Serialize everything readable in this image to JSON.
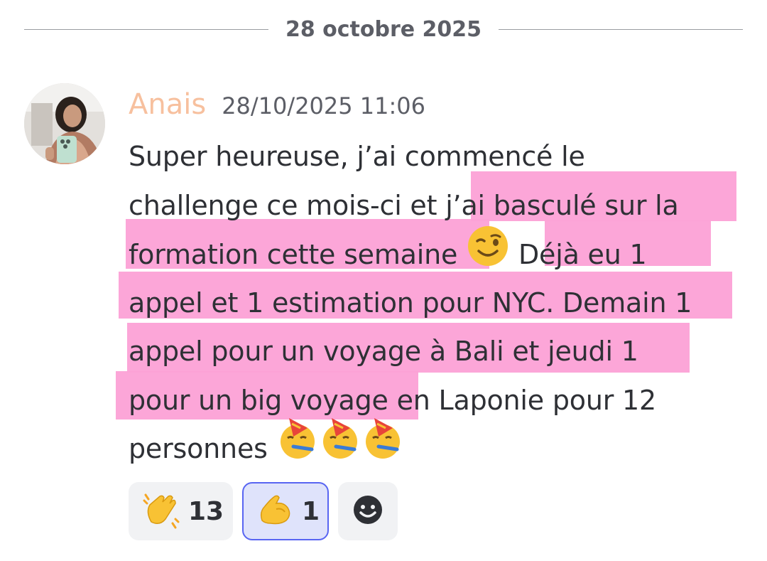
{
  "divider": {
    "date": "28 octobre 2025"
  },
  "message": {
    "author": "Anais",
    "timestamp": "28/10/2025 11:06",
    "lines": [
      {
        "before": "Super heureuse, j’ai commencé le",
        "highlight": "",
        "after": ""
      },
      {
        "before": "challenge ce mois-ci et ",
        "highlight": "j’ai basculé sur la",
        "after": ""
      },
      {
        "before": "",
        "highlight": "formation cette semaine",
        "after": ""
      },
      {
        "before": "",
        "highlight": "Déjà eu 1",
        "after": ""
      },
      {
        "before": "",
        "highlight": "appel et 1 estimation pour NYC. Demain 1",
        "after": ""
      },
      {
        "before": "",
        "highlight": "appel pour un voyage à Bali et jeudi 1",
        "after": ""
      },
      {
        "before": "",
        "highlight": "pour un big voyage",
        "after": " en Laponie pour 12"
      },
      {
        "before": "personnes",
        "highlight": "",
        "after": ""
      }
    ],
    "emojis": {
      "wink": "winking-face",
      "party": "partying-face"
    },
    "highlight_color": "#fca1d6"
  },
  "reactions": [
    {
      "emoji": "clapping-hands",
      "count": "13",
      "active": false
    },
    {
      "emoji": "flexed-biceps",
      "count": "1",
      "active": true
    }
  ],
  "add_reaction": {
    "icon": "smiley-add-reaction-icon"
  },
  "colors": {
    "author": "#f7c09e",
    "accent": "#5865f2"
  }
}
